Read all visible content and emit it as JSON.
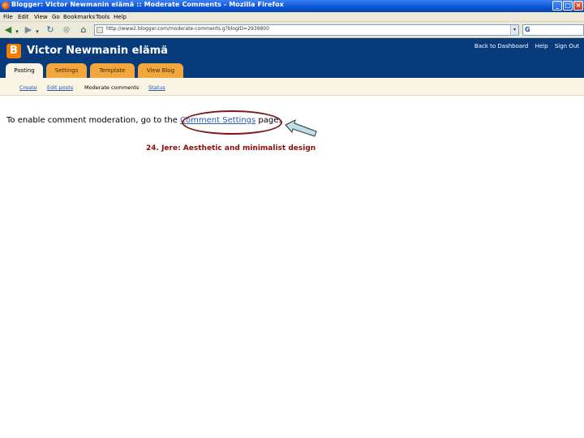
{
  "window": {
    "title": "Blogger: Victor Newmanin elämä :: Moderate Comments - Mozilla Firefox"
  },
  "menu": {
    "items": [
      "File",
      "Edit",
      "View",
      "Go",
      "Bookmarks",
      "Tools",
      "Help"
    ]
  },
  "toolbar": {
    "back_icon": "back-arrow-icon",
    "forward_icon": "forward-arrow-icon",
    "reload_icon": "reload-icon",
    "stop_icon": "stop-icon",
    "home_icon": "home-icon",
    "url": "http://www2.blogger.com/moderate-comments.g?blogID=2939800",
    "search_engine": "G"
  },
  "header": {
    "blog_title": "Victor Newmanin elämä",
    "links": [
      "Back to Dashboard",
      "Help",
      "Sign Out"
    ]
  },
  "tabs": [
    {
      "label": "Posting",
      "active": true
    },
    {
      "label": "Settings",
      "active": false
    },
    {
      "label": "Template",
      "active": false
    },
    {
      "label": "View Blog",
      "active": false
    }
  ],
  "subnav": [
    {
      "label": "Create",
      "active": false
    },
    {
      "label": "Edit posts",
      "active": false
    },
    {
      "label": "Moderate comments",
      "active": true
    },
    {
      "label": "Status",
      "active": false
    }
  ],
  "content": {
    "message_before": "To enable comment moderation, go to the ",
    "link_text": "Comment Settings",
    "message_after": " page."
  },
  "annotation": {
    "text": "24. Jere: Aesthetic and minimalist design",
    "color": "#8a0d0d"
  },
  "colors": {
    "header_bg": "#073b7b",
    "tab_bg": "#f2a63b",
    "subnav_bg": "#f8f3e3",
    "ellipse": "#7a1a1a",
    "arrow_fill": "#bcdfe8"
  }
}
